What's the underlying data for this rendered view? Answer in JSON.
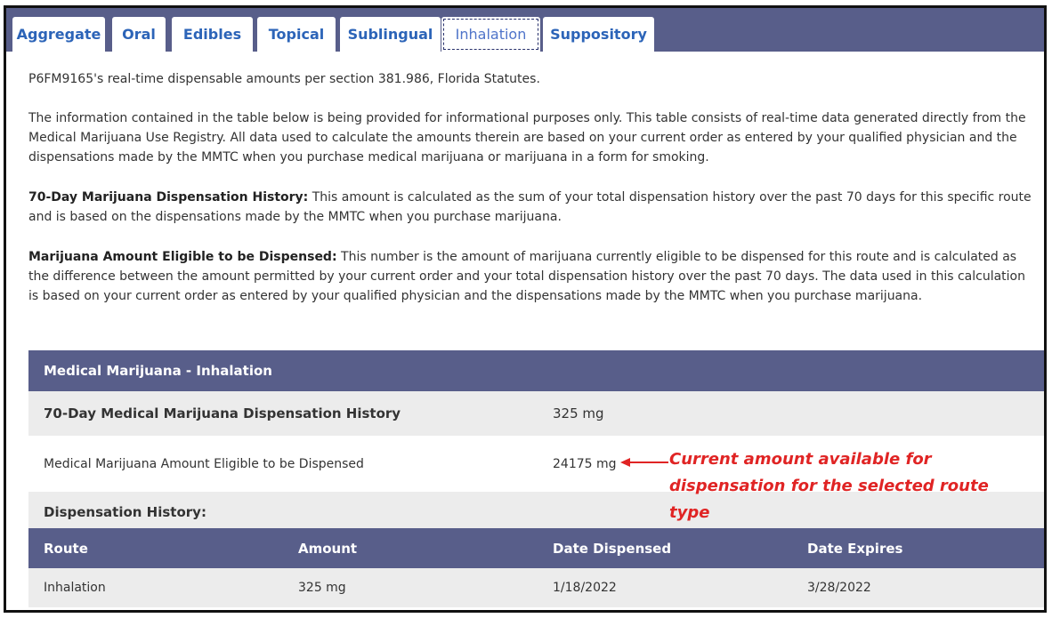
{
  "tabs": [
    {
      "label": "Aggregate",
      "active": false
    },
    {
      "label": "Oral",
      "active": false
    },
    {
      "label": "Edibles",
      "active": false
    },
    {
      "label": "Topical",
      "active": false
    },
    {
      "label": "Sublingual",
      "active": false
    },
    {
      "label": "Inhalation",
      "active": true
    },
    {
      "label": "Suppository",
      "active": false
    }
  ],
  "intro": {
    "line1": "P6FM9165's real-time dispensable amounts per section 381.986, Florida Statutes.",
    "para2": "The information contained in the table below is being provided for informational purposes only. This table consists of real-time data generated directly from the Medical Marijuana Use Registry. All data used to calculate the amounts therein are based on your current order as entered by your qualified physician and the dispensations made by the MMTC when you purchase medical marijuana or marijuana in a form for smoking.",
    "para3_label": "70-Day Marijuana Dispensation History:",
    "para3_text": " This amount is calculated as the sum of your total dispensation history over the past 70 days for this specific route and is based on the dispensations made by the MMTC when you purchase marijuana.",
    "para4_label": "Marijuana Amount Eligible to be Dispensed:",
    "para4_text": " This number is the amount of marijuana currently eligible to be dispensed for this route and is calculated as the difference between the amount permitted by your current order and your total dispensation history over the past 70 days. The data used in this calculation is based on your current order as entered by your qualified physician and the dispensations made by the MMTC when you purchase marijuana."
  },
  "summary": {
    "header": "Medical Marijuana - Inhalation",
    "history_label": "70-Day Medical Marijuana Dispensation History",
    "history_value": "325 mg",
    "eligible_label": "Medical Marijuana Amount Eligible to be Dispensed",
    "eligible_value": "24175 mg",
    "dispensation_history_label": "Dispensation History:"
  },
  "history_table": {
    "columns": [
      "Route",
      "Amount",
      "Date Dispensed",
      "Date Expires"
    ],
    "rows": [
      {
        "route": "Inhalation",
        "amount": "325 mg",
        "date_dispensed": "1/18/2022",
        "date_expires": "3/28/2022"
      }
    ]
  },
  "annotation": {
    "text": "Current amount available for dispensation for the selected route type",
    "color": "#e02424"
  },
  "colors": {
    "header_bar": "#585e8a",
    "tab_text": "#2c64b8",
    "row_shade": "#ececec"
  }
}
